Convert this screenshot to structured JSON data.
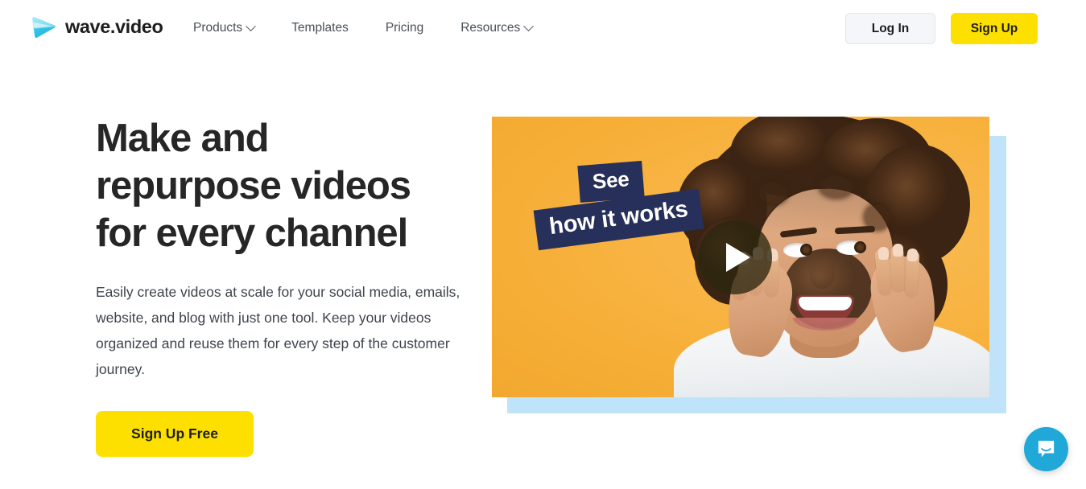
{
  "header": {
    "brand": {
      "name": "wave.video",
      "logo_icon": "wave-play-logo-icon"
    },
    "nav": [
      {
        "label": "Products",
        "has_dropdown": true,
        "icon": "chevron-down-icon"
      },
      {
        "label": "Templates",
        "has_dropdown": false
      },
      {
        "label": "Pricing",
        "has_dropdown": false
      },
      {
        "label": "Resources",
        "has_dropdown": true,
        "icon": "chevron-down-icon"
      }
    ],
    "login_label": "Log In",
    "signup_label": "Sign Up"
  },
  "hero": {
    "title_line1": "Make and",
    "title_line2": "repurpose videos",
    "title_line3": "for every channel",
    "subtitle": "Easily create videos at scale for your social media, emails, website, and blog with just one tool. Keep your videos organized and reuse them for every step of the customer journey.",
    "cta_label": "Sign Up Free"
  },
  "video": {
    "sticker_line1": "See",
    "sticker_line2": "how it works",
    "play_icon": "play-triangle-icon",
    "alt": "Smiling woman with curly hair resting face on hands against orange background"
  },
  "chat": {
    "icon": "chat-bubble-icon",
    "aria_label": "Open Intercom Messenger"
  },
  "colors": {
    "brand_yellow": "#fde000",
    "video_orange": "#f7b23e",
    "sticker_navy": "#27305b",
    "frame_blue": "#bfe3f8",
    "chat_blue": "#1fa8d8",
    "text_dark": "#262626",
    "text_body": "#3f444c",
    "logo_cyan": "#49d3f0"
  }
}
